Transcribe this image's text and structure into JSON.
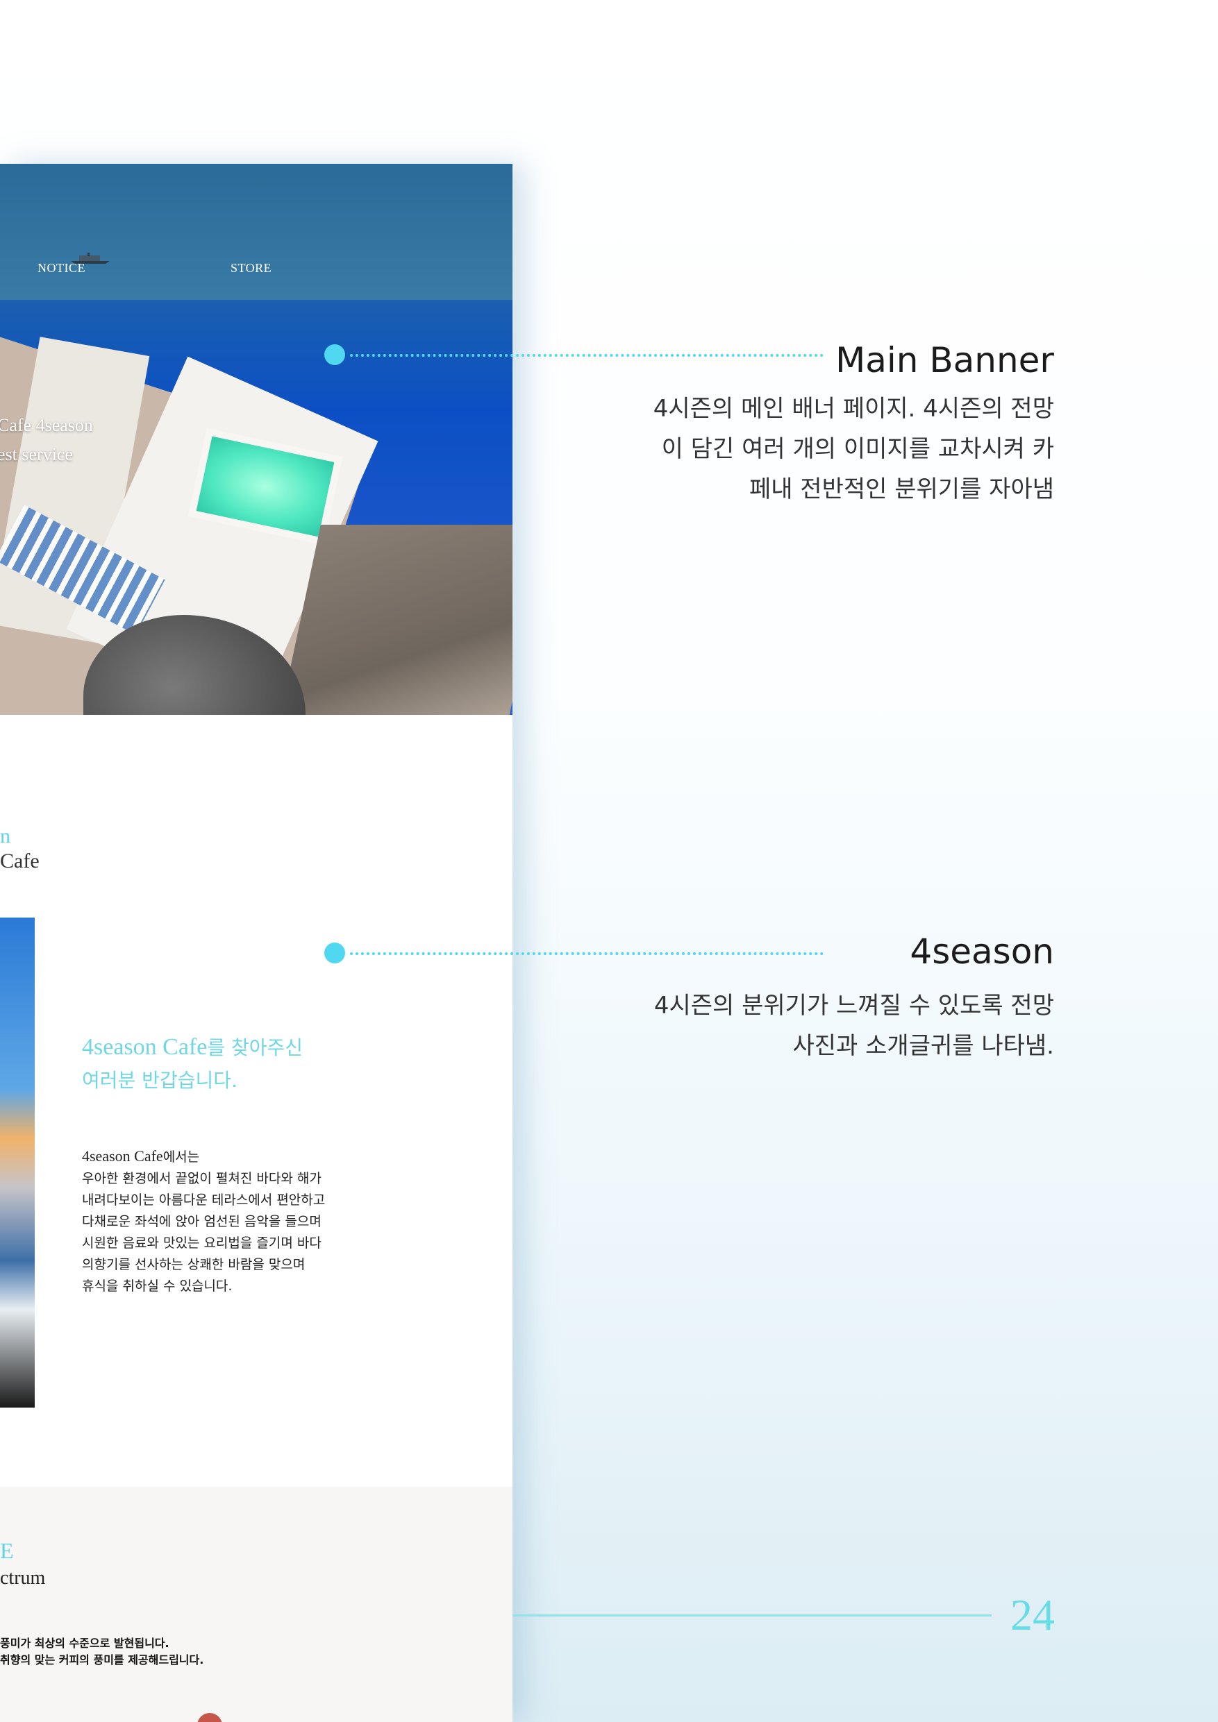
{
  "mockup": {
    "nav": [
      "NOTICE",
      "STORE"
    ],
    "banner_caption_line1": "Cafe 4season",
    "banner_caption_line2": "est service",
    "intro_title_fragment": "n",
    "intro_subtitle_fragment": "Cafe",
    "intro_heading_en": "4season Cafe",
    "intro_heading_ko1": "를 찾아주신",
    "intro_heading_ko2": "여러분 반갑습니다.",
    "intro_lead_en": "4season Cafe",
    "intro_lead_ko": "에서는",
    "intro_body": [
      "우아한 환경에서 끝없이 펼쳐진 바다와 해가",
      "내려다보이는 아름다운 테라스에서 편안하고",
      "다채로운 좌석에 앉아 엄선된 음악을 들으며",
      "시원한 음료와 맛있는 요리법을 즐기며 바다",
      "의향기를 선사하는 상쾌한 바람을 맞으며",
      "휴식을 취하실 수 있습니다."
    ],
    "notice_title_fragment": "E",
    "notice_subtitle_fragment": "ctrum",
    "notice_lines": [
      "풍미가 최상의 수준으로 발현됩니다.",
      "취향의 맞는 커피의 풍미를 제공해드립니다."
    ]
  },
  "annotations": [
    {
      "title": "Main Banner",
      "desc": [
        "4시즌의 메인 배너 페이지. 4시즌의 전망",
        "이 담긴 여러 개의 이미지를 교차시켜 카",
        "페내 전반적인 분위기를 자아냄"
      ]
    },
    {
      "title": "4season",
      "desc": [
        "4시즌의 분위기가 느껴질 수 있도록 전망",
        "사진과 소개글귀를 나타냄."
      ]
    }
  ],
  "page_number": "24",
  "colors": {
    "accent": "#4fd8f0",
    "heading_cyan": "#6fd7e3"
  },
  "icons": [
    "arrow-right-icon",
    "anchor-dot-icon"
  ]
}
